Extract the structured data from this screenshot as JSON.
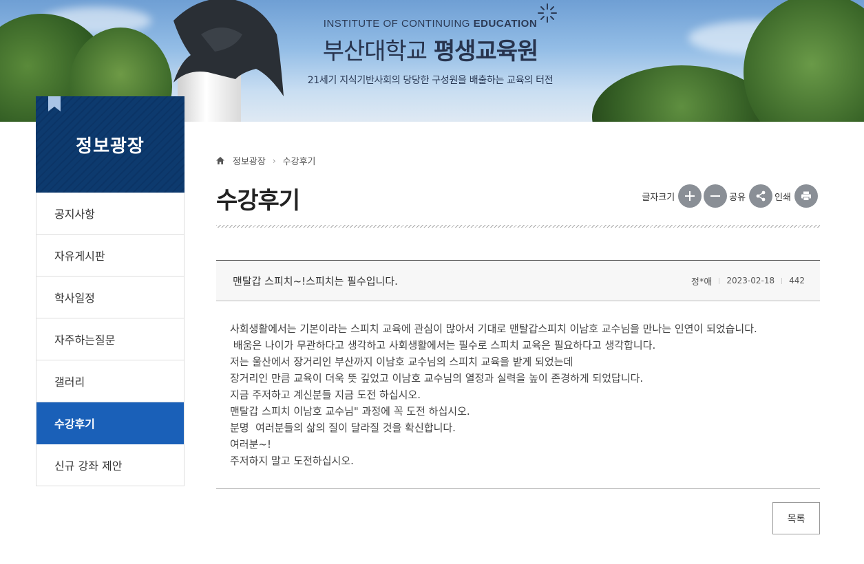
{
  "banner": {
    "en_prefix": "INSTITUTE OF CONTINUING ",
    "en_bold": "EDUCATION",
    "title_light": "부산대학교 ",
    "title_bold": "평생교육원",
    "subtitle": "21세기 지식기반사회의 당당한 구성원을 배출하는 교육의 터전"
  },
  "sidebar": {
    "title": "정보광장",
    "items": [
      {
        "label": "공지사항"
      },
      {
        "label": "자유게시판"
      },
      {
        "label": "학사일정"
      },
      {
        "label": "자주하는질문"
      },
      {
        "label": "갤러리"
      },
      {
        "label": "수강후기",
        "active": true
      },
      {
        "label": "신규 강좌 제안"
      }
    ]
  },
  "breadcrumb": {
    "items": [
      "정보광장",
      "수강후기"
    ],
    "icon": "home-icon"
  },
  "page": {
    "title": "수강후기"
  },
  "tools": {
    "font_size_label": "글자크기",
    "share_label": "공유",
    "print_label": "인쇄",
    "icons": [
      "plus-icon",
      "minus-icon",
      "share-icon",
      "print-icon"
    ]
  },
  "post": {
    "subject": "맨탈갑 스피치~!스피치는 필수입니다.",
    "author": "정*애",
    "date": "2023-02-18",
    "views": "442",
    "lines": [
      "사회생활에서는 기본이라는 스피치 교육에 관심이 많아서 기대로 맨탈갑스피치 이남호 교수님을 만나는 인연이 되었습니다.",
      " 배움은 나이가 무관하다고 생각하고 사회생활에서는 필수로 스피치 교육은 필요하다고 생각합니다.",
      "저는 울산에서 장거리인 부산까지 이남호 교수님의 스피치 교육을 받게 되었는데",
      "장거리인 만큼 교육이 더욱 뜻 깊었고 이남호 교수님의 열정과 실력을 높이 존경하게 되었답니다.",
      "지금 주저하고 계신분들 지금 도전 하십시오.",
      "맨탈갑 스피치 이남호 교수님\" 과정에 꼭 도전 하십시오.",
      "분명  여러분들의 삶의 질이 달라질 것을 확신합니다.",
      "여러분~!",
      "주저하지 말고 도전하십시오."
    ]
  },
  "actions": {
    "list_label": "목록"
  },
  "colors": {
    "sidebar_head": "#0d3a6e",
    "active_item": "#1a60b8",
    "tool_button": "#8a8f96"
  }
}
